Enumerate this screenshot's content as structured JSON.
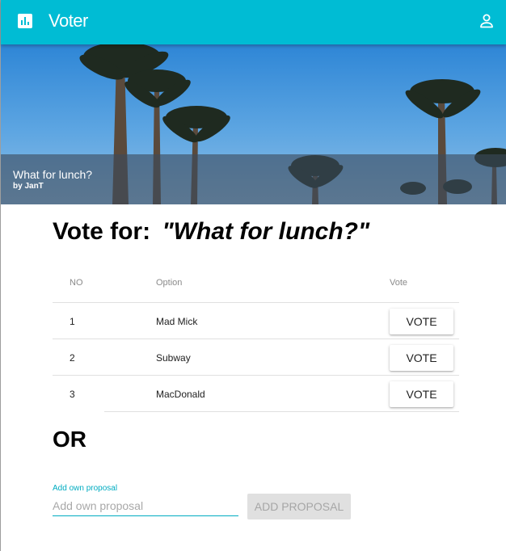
{
  "toolbar": {
    "app_title": "Voter",
    "logo_icon": "bar-chart-icon",
    "account_icon": "person-icon",
    "color": "#00bcd4"
  },
  "hero": {
    "title": "What for lunch?",
    "author": "by JanT"
  },
  "poll": {
    "heading_prefix": "Vote for:",
    "heading_question": "\"What for lunch?\""
  },
  "table": {
    "headers": {
      "no": "NO",
      "option": "Option",
      "vote": "Vote"
    },
    "rows": [
      {
        "no": "1",
        "option": "Mad Mick",
        "action": "VOTE"
      },
      {
        "no": "2",
        "option": "Subway",
        "action": "VOTE"
      },
      {
        "no": "3",
        "option": "MacDonald",
        "action": "VOTE"
      }
    ]
  },
  "or_text": "OR",
  "proposal": {
    "label": "Add own proposal",
    "placeholder": "Add own proposal",
    "value": "",
    "button": "ADD PROPOSAL"
  }
}
